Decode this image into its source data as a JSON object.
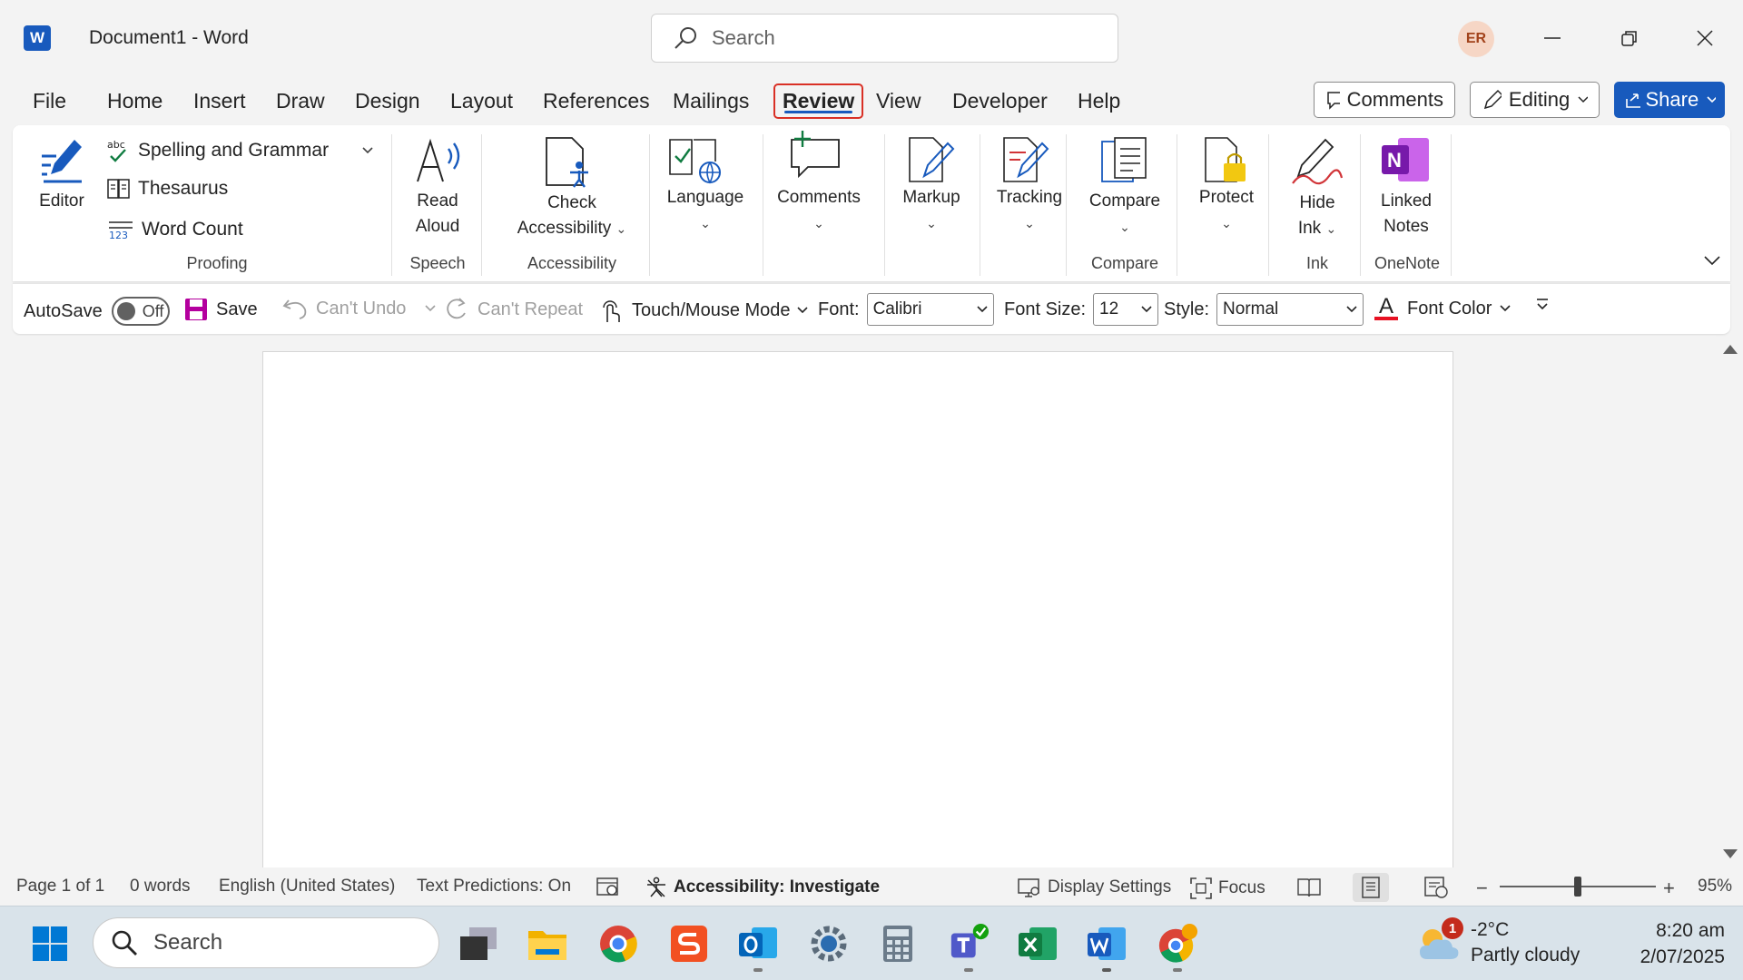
{
  "titlebar": {
    "app_logo": "W",
    "document_title": "Document1  -  Word",
    "search_placeholder": "Search",
    "user_initials": "ER"
  },
  "menu": {
    "items": [
      "File",
      "Home",
      "Insert",
      "Draw",
      "Design",
      "Layout",
      "References",
      "Mailings",
      "Review",
      "View",
      "Developer",
      "Help"
    ],
    "active": "Review",
    "comments_label": "Comments",
    "editing_label": "Editing",
    "share_label": "Share"
  },
  "ribbon": {
    "editor": "Editor",
    "spelling": "Spelling and Grammar",
    "thesaurus": "Thesaurus",
    "word_count": "Word Count",
    "proofing": "Proofing",
    "read_aloud_1": "Read",
    "read_aloud_2": "Aloud",
    "speech": "Speech",
    "check_access_1": "Check",
    "check_access_2": "Accessibility",
    "accessibility": "Accessibility",
    "language": "Language",
    "comments": "Comments",
    "markup": "Markup",
    "tracking": "Tracking",
    "compare_btn": "Compare",
    "compare_group": "Compare",
    "protect": "Protect",
    "hide_ink_1": "Hide",
    "hide_ink_2": "Ink",
    "ink": "Ink",
    "linked_notes_1": "Linked",
    "linked_notes_2": "Notes",
    "onenote": "OneNote",
    "spell_icon_text": "abc",
    "onenote_logo": "N"
  },
  "qat": {
    "autosave": "AutoSave",
    "autosave_state": "Off",
    "save": "Save",
    "undo": "Can't Undo",
    "repeat": "Can't Repeat",
    "touch_mode": "Touch/Mouse Mode",
    "font_label": "Font:",
    "font_value": "Calibri",
    "font_size_label": "Font Size:",
    "font_size_value": "12",
    "style_label": "Style:",
    "style_value": "Normal",
    "font_color": "Font Color",
    "font_color_glyph": "A"
  },
  "status": {
    "page": "Page 1 of 1",
    "words": "0 words",
    "language": "English (United States)",
    "predictions": "Text Predictions: On",
    "accessibility": "Accessibility: Investigate",
    "display_settings": "Display Settings",
    "focus": "Focus",
    "zoom": "95%",
    "zoom_level": 0.5
  },
  "taskbar": {
    "search_placeholder": "Search",
    "weather_badge": "1",
    "temperature": "-2°C",
    "condition": "Partly cloudy",
    "time": "8:20 am",
    "date": "2/07/2025"
  },
  "colors": {
    "brand": "#185abd",
    "active_outline": "#d93025",
    "font_color_bar": "#e81123"
  }
}
